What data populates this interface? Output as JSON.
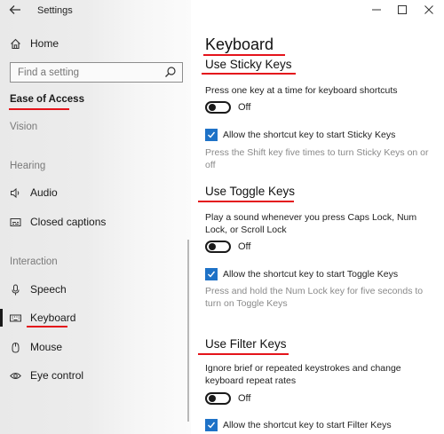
{
  "window": {
    "title": "Settings"
  },
  "sidebar": {
    "home_label": "Home",
    "search_placeholder": "Find a setting",
    "category_title": "Ease of Access",
    "sections": {
      "vision": "Vision",
      "hearing": "Hearing",
      "interaction": "Interaction"
    },
    "items": [
      {
        "label": "Audio",
        "icon": "speaker-icon"
      },
      {
        "label": "Closed captions",
        "icon": "closed-captions-icon"
      },
      {
        "label": "Speech",
        "icon": "microphone-icon"
      },
      {
        "label": "Keyboard",
        "icon": "keyboard-icon",
        "selected": true
      },
      {
        "label": "Mouse",
        "icon": "mouse-icon"
      },
      {
        "label": "Eye control",
        "icon": "eye-icon"
      }
    ]
  },
  "main": {
    "title": "Keyboard",
    "sticky": {
      "title": "Use Sticky Keys",
      "description": "Press one key at a time for keyboard shortcuts",
      "toggle_state": "Off",
      "checkbox_label": "Allow the shortcut key to start Sticky Keys",
      "checkbox_checked": true,
      "hint": "Press the Shift key five times to turn Sticky Keys on or off"
    },
    "toggle_keys": {
      "title": "Use Toggle Keys",
      "description": "Play a sound whenever you press Caps Lock, Num Lock, or Scroll Lock",
      "toggle_state": "Off",
      "checkbox_label": "Allow the shortcut key to start Toggle Keys",
      "checkbox_checked": true,
      "hint": "Press and hold the Num Lock key for five seconds to turn on Toggle Keys"
    },
    "filter": {
      "title": "Use Filter Keys",
      "description": "Ignore brief or repeated keystrokes and change keyboard repeat rates",
      "toggle_state": "Off",
      "checkbox_label": "Allow the shortcut key to start Filter Keys",
      "checkbox_checked": true
    }
  },
  "colors": {
    "accent": "#1e72c7",
    "annotation_underline": "#e4141b"
  }
}
